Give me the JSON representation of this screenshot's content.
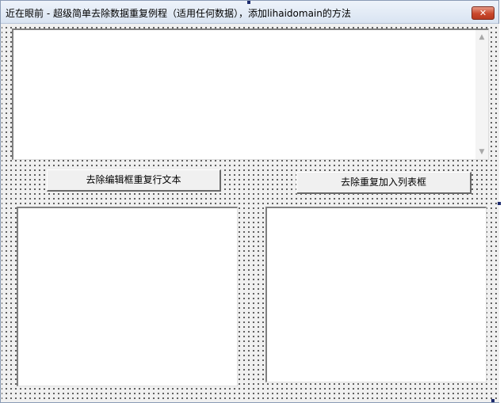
{
  "window": {
    "title": "近在眼前 - 超级简单去除数据重复例程（适用任何数据），添加lihaidomain的方法",
    "close_glyph": "✕"
  },
  "edit_box": {
    "text": "",
    "scroll_up_glyph": "▲",
    "scroll_down_glyph": "▼"
  },
  "buttons": {
    "dedupe_edit_lines": "去除编辑框重复行文本",
    "dedupe_to_list": "去除重复加入列表框"
  },
  "lists": {
    "left_items": [],
    "right_items": []
  },
  "colors": {
    "close_button": "#c9482c",
    "selection_marker": "#1d2b6e"
  }
}
